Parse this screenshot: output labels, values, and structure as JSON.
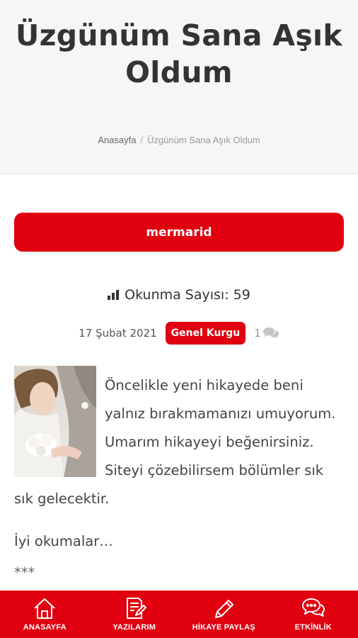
{
  "page": {
    "title": "Üzgünüm Sana Aşık Oldum"
  },
  "breadcrumb": {
    "home": "Anasayfa",
    "separator": "/",
    "current": "Üzgünüm Sana Aşık Oldum"
  },
  "author": {
    "name": "mermarid"
  },
  "stats": {
    "reads_label": "Okunma Sayısı: 59",
    "date": "17 Şubat 2021",
    "category": "Genel Kurgu",
    "comment_count": "1"
  },
  "article": {
    "paragraph_1": "Öncelikle yeni hikayede beni yalnız bırakmamanızı umuyorum. Umarım hikayeyi beğenirsiniz. Siteyi çözebilirsem bölümler sık sık gelecektir.",
    "paragraph_2": "İyi okumalar…",
    "paragraph_3": "***"
  },
  "tabbar": {
    "items": [
      {
        "label": "ANASAYFA",
        "icon": "home-icon"
      },
      {
        "label": "YAZILARIM",
        "icon": "document-edit-icon"
      },
      {
        "label": "HİKAYE PAYLAŞ",
        "icon": "pencil-icon"
      },
      {
        "label": "ETKİNLİK",
        "icon": "chat-bubbles-icon"
      }
    ]
  },
  "colors": {
    "brand_red": "#e0000f",
    "hero_bg": "#f6f6f6"
  }
}
